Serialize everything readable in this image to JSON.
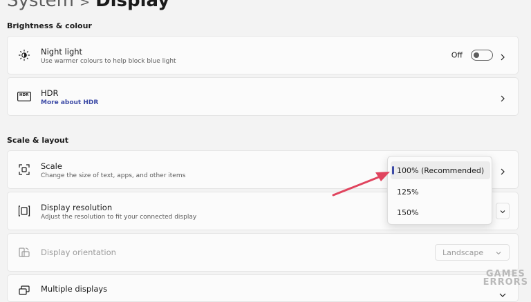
{
  "header": {
    "breadcrumb_parent": "System",
    "separator": ">",
    "current": "Display"
  },
  "sections": {
    "brightness": "Brightness & colour",
    "scale_layout": "Scale & layout"
  },
  "night_light": {
    "title": "Night light",
    "subtitle": "Use warmer colours to help block blue light",
    "toggle_state": "Off",
    "icon": "brightness-icon"
  },
  "hdr": {
    "title": "HDR",
    "link": "More about HDR",
    "icon": "hdr-icon",
    "icon_text": "HDR"
  },
  "scale": {
    "title": "Scale",
    "subtitle": "Change the size of text, apps, and other items",
    "icon": "scale-icon"
  },
  "resolution": {
    "title": "Display resolution",
    "subtitle": "Adjust the resolution to fit your connected display",
    "icon": "resolution-icon"
  },
  "orientation": {
    "title": "Display orientation",
    "value": "Landscape",
    "icon": "orientation-icon"
  },
  "multiple": {
    "title": "Multiple displays",
    "icon": "multiple-displays-icon"
  },
  "scale_dropdown": {
    "options": [
      "100% (Recommended)",
      "125%",
      "150%"
    ],
    "selected_index": 0
  },
  "watermark": {
    "line1": "GAMES",
    "line2": "ERRORS"
  },
  "colors": {
    "accent": "#3c4aa6",
    "arrow": "#e0445e",
    "background": "#f3f3f3",
    "card": "#fbfbfb"
  }
}
